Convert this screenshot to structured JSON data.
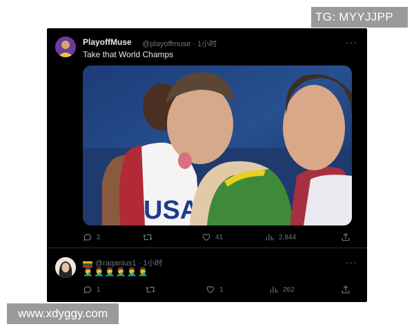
{
  "watermarks": {
    "top": "TG: MYYJJPP",
    "bottom": "www.xdyggy.com"
  },
  "tweet": {
    "author_name": "PlayoffMuse",
    "handle_time": "@playoffmuse · 1小时",
    "text": "Take that World Champs",
    "more": "···",
    "media": {
      "jersey_text": "USA"
    },
    "actions": {
      "replies": "2",
      "retweets": "",
      "likes": "41",
      "views": "2,844"
    }
  },
  "reply": {
    "handle_time": "@raqanius1 · 1小时",
    "text": "🤦‍♂️🤦‍♂️🤦‍♂️🤦‍♂️🤦‍♂️🤦‍♂️",
    "more": "···",
    "actions": {
      "replies": "1",
      "retweets": "",
      "likes": "1",
      "views": "262"
    }
  },
  "colors": {
    "background": "#000000",
    "text": "#e7e9ea",
    "muted": "#71767b",
    "divider": "#2f3336"
  },
  "icons": [
    "reply-icon",
    "retweet-icon",
    "like-icon",
    "views-icon",
    "share-icon",
    "more-icon"
  ]
}
